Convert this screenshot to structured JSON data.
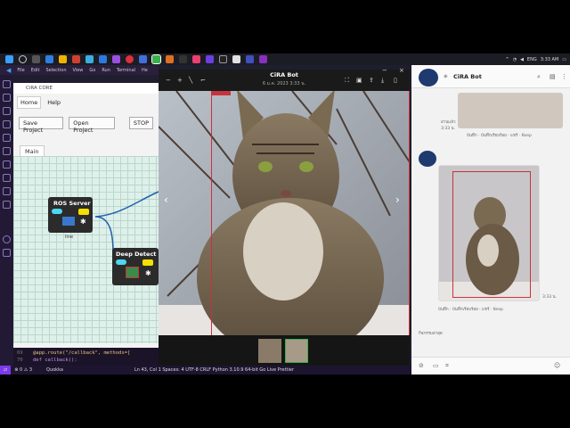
{
  "taskbar": {
    "lang": "ENG",
    "time": "3:33 AM"
  },
  "vscode": {
    "menu": [
      "File",
      "Edit",
      "Selection",
      "View",
      "Go",
      "Run",
      "Terminal",
      "He"
    ],
    "code_line1_num": "69",
    "code_line1": "@app.route(\"/callback\", methods=[",
    "code_line2_num": "70",
    "code_line2": "def callback():",
    "status_left": "⊗ 0 ⚠ 3",
    "status_quokka": "Quokka",
    "status_right": "Ln 43, Col 1   Spaces: 4   UTF-8   CRLF   Python   3.10.9 64-bit   Go Live   Prettier"
  },
  "cira": {
    "title": "CiRA CORE",
    "menu_home": "Home",
    "menu_help": "Help",
    "save": "Save Project",
    "open": "Open Project",
    "stop": "STOP",
    "tab_main": "Main",
    "node1_title": "ROS Server",
    "node1_label": "line",
    "node2_title": "Deep Detect"
  },
  "viewer": {
    "title": "CiRA Bot",
    "subtitle": "6 ม.ค. 2023 3:33 น."
  },
  "chat": {
    "name": "CiRA Bot",
    "msg_meta": "บันทึก · บันทึกเรียบร้อย · แชร์ · Keep",
    "time1": "3:33 น.",
    "time2": "3:33 น.",
    "read": "อ่านแล้ว",
    "status": "กิจกรรมล่าสุด"
  },
  "colors": {
    "accent": "#7c3aed",
    "detect_box": "#c8323c"
  }
}
